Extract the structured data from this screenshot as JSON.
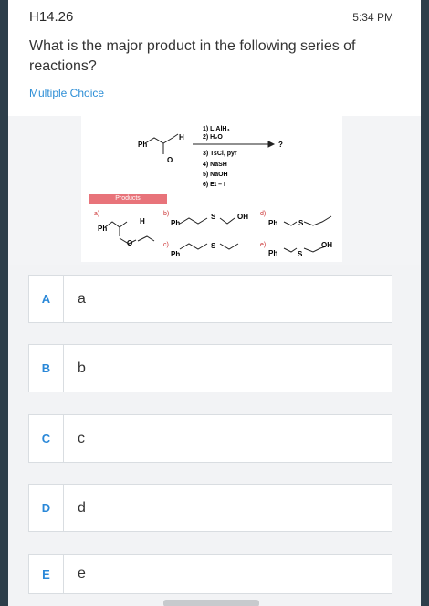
{
  "header": {
    "question_id": "H14.26",
    "time": "5:34 PM",
    "question_text": "What is the major product in the following series of reactions?",
    "question_type": "Multiple Choice"
  },
  "figure": {
    "reactant_labels": {
      "ph": "Ph",
      "h": "H",
      "o": "O"
    },
    "conditions": [
      "1) LiAlH₄",
      "2) H₂O",
      "3) TsCl, pyr",
      "4) NaSH",
      "5) NaOH",
      "6) Et – I"
    ],
    "question_mark": "?",
    "products_label": "Products",
    "products": [
      {
        "tag": "a)",
        "labels": [
          "Ph",
          "H",
          "O"
        ]
      },
      {
        "tag": "b)",
        "labels": [
          "Ph",
          "S",
          "OH"
        ]
      },
      {
        "tag": "c)",
        "labels": [
          "Ph",
          "S"
        ]
      },
      {
        "tag": "d)",
        "labels": [
          "Ph",
          "S"
        ]
      },
      {
        "tag": "e)",
        "labels": [
          "Ph",
          "S",
          "OH"
        ]
      }
    ]
  },
  "choices": [
    {
      "letter": "A",
      "text": "a"
    },
    {
      "letter": "B",
      "text": "b"
    },
    {
      "letter": "C",
      "text": "c"
    },
    {
      "letter": "D",
      "text": "d"
    },
    {
      "letter": "E",
      "text": "e"
    }
  ],
  "colors": {
    "accent": "#2a88d8",
    "products_banner": "#e8737a"
  }
}
